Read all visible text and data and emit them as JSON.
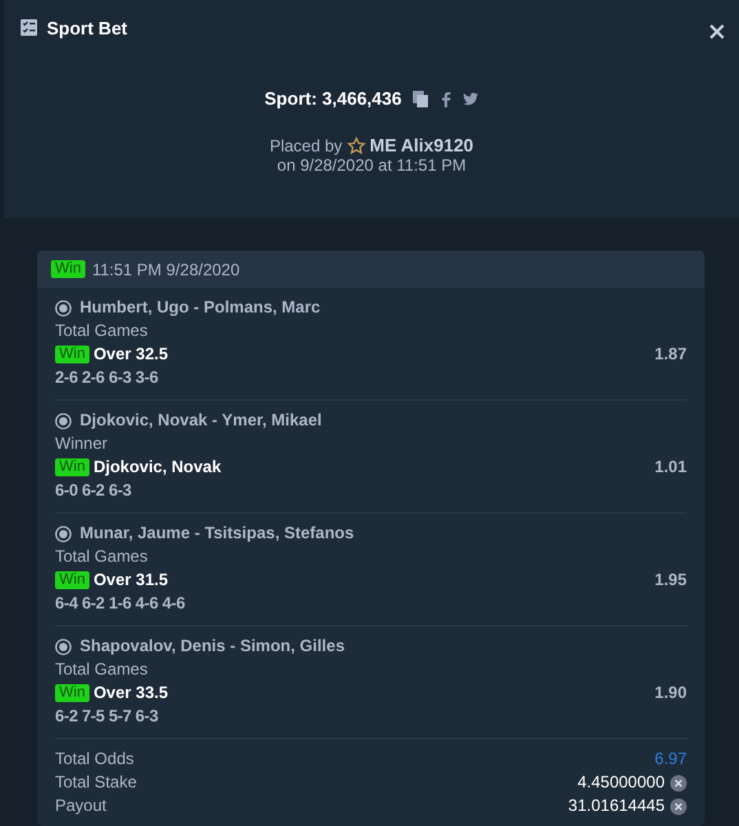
{
  "window": {
    "title": "Sport Bet"
  },
  "bet": {
    "label": "Sport: 3,466,436",
    "placed_by_prefix": "Placed by",
    "user": "ME Alix9120",
    "placed_on": "on 9/28/2020 at 11:51 PM"
  },
  "slip": {
    "status": "Win",
    "time": "11:51 PM 9/28/2020",
    "selections": [
      {
        "event": "Humbert, Ugo - Polmans, Marc",
        "market": "Total Games",
        "status": "Win",
        "pick": "Over 32.5",
        "odds": "1.87",
        "score": "2-6 2-6 6-3 3-6"
      },
      {
        "event": "Djokovic, Novak - Ymer, Mikael",
        "market": "Winner",
        "status": "Win",
        "pick": "Djokovic, Novak",
        "odds": "1.01",
        "score": "6-0 6-2 6-3"
      },
      {
        "event": "Munar, Jaume - Tsitsipas, Stefanos",
        "market": "Total Games",
        "status": "Win",
        "pick": "Over 31.5",
        "odds": "1.95",
        "score": "6-4 6-2 1-6 4-6 4-6"
      },
      {
        "event": "Shapovalov, Denis - Simon, Gilles",
        "market": "Total Games",
        "status": "Win",
        "pick": "Over 33.5",
        "odds": "1.90",
        "score": "6-2 7-5 5-7 6-3"
      }
    ],
    "totals": [
      {
        "kind": "odds",
        "label": "Total Odds",
        "value": "6.97"
      },
      {
        "kind": "amount",
        "label": "Total Stake",
        "value": "4.45000000"
      },
      {
        "kind": "amount",
        "label": "Payout",
        "value": "31.01614445"
      }
    ]
  }
}
